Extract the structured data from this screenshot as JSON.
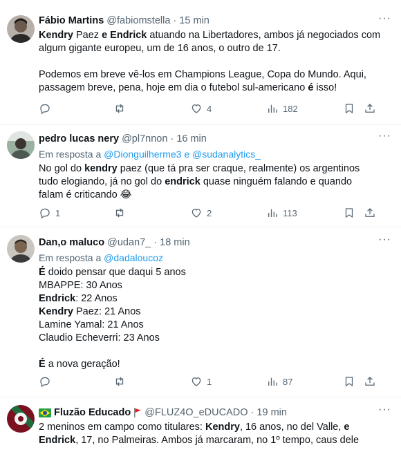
{
  "tweets": [
    {
      "name": "Fábio Martins",
      "handle": "@fabiomstella",
      "time": "15 min",
      "body_lines": [
        [
          {
            "t": "Kendry",
            "b": true
          },
          {
            "t": " Paez "
          },
          {
            "t": "e Endrick",
            "b": true
          },
          {
            "t": " atuando na Libertadores, ambos já negociados com"
          }
        ],
        [
          {
            "t": "algum gigante europeu, um de 16 anos, o outro de 17."
          }
        ],
        [],
        [
          {
            "t": "Podemos em breve vê-los em Champions League, Copa do Mundo. Aqui,"
          }
        ],
        [
          {
            "t": "passagem breve, pena, hoje em dia o futebol sul-americano "
          },
          {
            "t": "é",
            "b": true
          },
          {
            "t": " isso!"
          }
        ]
      ],
      "replies": "",
      "retweets": "",
      "likes": "4",
      "views": "182"
    },
    {
      "name": "pedro lucas nery",
      "handle": "@pl7nnon",
      "time": "16 min",
      "reply_prefix": "Em resposta a ",
      "reply_to": "@Dionguilherme3 e @sudanalytics_",
      "body_lines": [
        [
          {
            "t": "No gol do "
          },
          {
            "t": "kendry",
            "b": true
          },
          {
            "t": " paez (que tá pra ser craque, realmente) os argentinos"
          }
        ],
        [
          {
            "t": "tudo elogiando, já no gol do "
          },
          {
            "t": "endrick",
            "b": true
          },
          {
            "t": " quase ninguém falando e quando"
          }
        ],
        [
          {
            "t": "falam é criticando 😂"
          }
        ]
      ],
      "replies": "1",
      "retweets": "",
      "likes": "2",
      "views": "113"
    },
    {
      "name": "Dan,o maluco",
      "handle": "@udan7_",
      "time": "18 min",
      "reply_prefix": "Em resposta a ",
      "reply_to": "@dadaloucoz",
      "body_lines": [
        [
          {
            "t": "É",
            "b": true
          },
          {
            "t": " doido pensar que daqui 5 anos"
          }
        ],
        [
          {
            "t": "MBAPPE: 30 Anos"
          }
        ],
        [
          {
            "t": "Endrick",
            "b": true
          },
          {
            "t": ": 22 Anos"
          }
        ],
        [
          {
            "t": "Kendry",
            "b": true
          },
          {
            "t": " Paez: 21 Anos"
          }
        ],
        [
          {
            "t": "Lamine Yamal: 21 Anos"
          }
        ],
        [
          {
            "t": "Claudio Echeverri: 23 Anos"
          }
        ],
        [],
        [
          {
            "t": "É",
            "b": true
          },
          {
            "t": " a nova geração!"
          }
        ]
      ],
      "replies": "",
      "retweets": "",
      "likes": "1",
      "views": "87"
    },
    {
      "name": "Fluzão Educado",
      "handle": "@FLUZ4O_eDUCADO",
      "time": "19 min",
      "body_lines": [
        [
          {
            "t": "2 meninos em campo como titulares: "
          },
          {
            "t": "Kendry",
            "b": true
          },
          {
            "t": ", 16 anos, no del Valle, "
          },
          {
            "t": "e",
            "b": true
          }
        ],
        [
          {
            "t": "Endrick",
            "b": true
          },
          {
            "t": ", 17, no Palmeiras. Ambos já marcaram, no 1º tempo, caus dele"
          }
        ]
      ]
    }
  ],
  "separator": "·",
  "more_glyph": "···",
  "colors": {
    "link": "#1d9bf0",
    "muted": "#536471",
    "text": "#0f1419"
  }
}
